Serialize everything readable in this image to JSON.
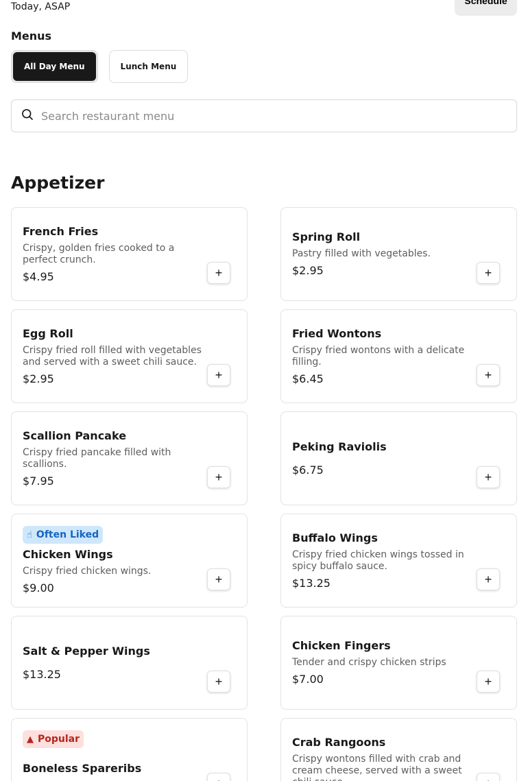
{
  "header": {
    "delivery_time": "Today, ASAP",
    "schedule_label": "Schedule"
  },
  "menus": {
    "label": "Menus",
    "tabs": [
      {
        "label": "All Day Menu",
        "active": true
      },
      {
        "label": "Lunch Menu",
        "active": false
      }
    ]
  },
  "search": {
    "placeholder": "Search restaurant menu",
    "icon": "search-icon"
  },
  "section": {
    "title": "Appetizer"
  },
  "items": [
    {
      "name": "French Fries",
      "desc": "Crispy, golden fries cooked to a perfect crunch.",
      "price": "$4.95"
    },
    {
      "name": "Spring Roll",
      "desc": "Pastry filled with vegetables.",
      "price": "$2.95"
    },
    {
      "name": "Egg Roll",
      "desc": "Crispy fried roll filled with vegetables and served with a sweet chili sauce.",
      "price": "$2.95"
    },
    {
      "name": "Fried Wontons",
      "desc": "Crispy fried wontons with a delicate filling.",
      "price": "$6.45"
    },
    {
      "name": "Scallion Pancake",
      "desc": "Crispy fried pancake filled with scallions.",
      "price": "$7.95"
    },
    {
      "name": "Peking Raviolis",
      "desc": "",
      "price": "$6.75"
    },
    {
      "name": "Chicken Wings",
      "desc": "Crispy fried chicken wings.",
      "price": "$9.00",
      "badge": {
        "label": "Often Liked",
        "icon": "thumbs-up-icon"
      }
    },
    {
      "name": "Buffalo Wings",
      "desc": "Crispy fried chicken wings tossed in spicy buffalo sauce.",
      "price": "$13.25"
    },
    {
      "name": "Salt & Pepper Wings",
      "desc": "",
      "price": "$13.25"
    },
    {
      "name": "Chicken Fingers",
      "desc": "Tender and crispy chicken strips",
      "price": "$7.00"
    },
    {
      "name": "Boneless Spareribs",
      "desc": "",
      "price": "",
      "badge": {
        "label": "Popular",
        "icon": "fire-icon"
      }
    },
    {
      "name": "Crab Rangoons",
      "desc": "Crispy wontons filled with crab and cream cheese, served with a sweet chili sauce.",
      "price": ""
    }
  ],
  "add_button_label": "+"
}
